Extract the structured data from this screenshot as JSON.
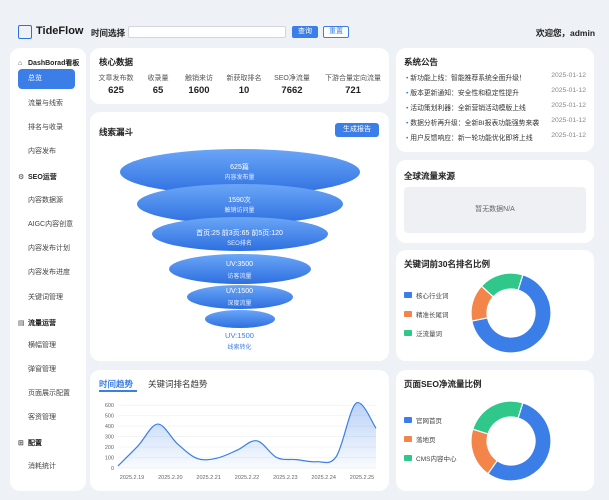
{
  "app": {
    "name": "TideFlow"
  },
  "topbar": {
    "time_label": "时间选择",
    "query_btn": "查询",
    "reset_btn": "重置",
    "welcome": "欢迎您，admin"
  },
  "sidebar": {
    "groups": [
      {
        "label": "DashBorad看板",
        "icon": "home-icon",
        "items": [
          "总览",
          "流量与线索",
          "排名与收录",
          "内容发布"
        ]
      },
      {
        "label": "SEO运营",
        "icon": "gear-icon",
        "items": [
          "内容数据源",
          "AIGC内容创意",
          "内容发布计划",
          "内容发布进度",
          "关键词管理"
        ]
      },
      {
        "label": "流量运营",
        "icon": "calendar-icon",
        "items": [
          "横幅管理",
          "弹窗管理",
          "页面展示配置",
          "客资管理"
        ]
      },
      {
        "label": "配置",
        "icon": "grid-icon",
        "items": [
          "消耗统计"
        ]
      }
    ],
    "active": "总览"
  },
  "core": {
    "title": "核心数据",
    "stats": [
      {
        "label": "文章发布数",
        "value": "625"
      },
      {
        "label": "收录量",
        "value": "65"
      },
      {
        "label": "触销来访",
        "value": "1600"
      },
      {
        "label": "新获取排名",
        "value": "10"
      },
      {
        "label": "SEO净流量",
        "value": "7662"
      },
      {
        "label": "下游合量定向流量",
        "value": "721"
      }
    ]
  },
  "funnel": {
    "title": "线索漏斗",
    "report_btn": "生成报告",
    "layers": [
      {
        "value": "625篇",
        "label": "内容发布量"
      },
      {
        "value": "1590次",
        "label": "触销访问量"
      },
      {
        "value": "首页:25 前3页:65 前5页:120",
        "label": "SEO排名"
      },
      {
        "value": "UV:3500",
        "label": "访客流量"
      },
      {
        "value": "UV:1500",
        "label": "深度流量"
      },
      {
        "value": "UV:1500",
        "label": "线索转化"
      }
    ]
  },
  "announcements": {
    "title": "系统公告",
    "items": [
      {
        "text": "新功能上线：智能推荐系统全面升级！",
        "date": "2025-01-12"
      },
      {
        "text": "版本更新通知：安全性和稳定性提升",
        "date": "2025-01-12"
      },
      {
        "text": "活动策划利器：全新营销活动模版上线",
        "date": "2025-01-12"
      },
      {
        "text": "数据分析再升级：全新BI报表功能强势来袭",
        "date": "2025-01-12"
      },
      {
        "text": "用户反馈响应：新一轮功能优化即将上线",
        "date": "2025-01-12"
      }
    ]
  },
  "global": {
    "title": "全球流量来源",
    "empty": "暂无数据N/A"
  },
  "keyword_pie": {
    "title": "关键词前30名排名比例",
    "legend": [
      {
        "name": "核心行业词",
        "color": "#3b7ee8"
      },
      {
        "name": "精准长尾词",
        "color": "#f3844a"
      },
      {
        "name": "泛流量词",
        "color": "#2fc88a"
      }
    ]
  },
  "seo_pie": {
    "title": "页面SEO净流量比例",
    "legend": [
      {
        "name": "官网首页",
        "color": "#3b7ee8"
      },
      {
        "name": "落地页",
        "color": "#f3844a"
      },
      {
        "name": "CMS内容中心",
        "color": "#2fc88a"
      }
    ]
  },
  "trend": {
    "tabs": [
      "时间趋势",
      "关键词排名趋势"
    ],
    "active_tab": "时间趋势"
  },
  "chart_data": [
    {
      "type": "line",
      "title": "",
      "x": [
        "2025.2.19",
        "2025.2.20",
        "2025.2.21",
        "2025.2.22",
        "2025.2.23",
        "2025.2.24",
        "2025.2.25"
      ],
      "series": [
        {
          "values": [
            20,
            210,
            420,
            230,
            90,
            95,
            170,
            260,
            100,
            80,
            60,
            110,
            620,
            380
          ],
          "x": [
            "2025.2.19",
            "2025.2.19.5",
            "2025.2.20",
            "2025.2.20.5",
            "2025.2.21",
            "2025.2.21.5",
            "2025.2.22",
            "2025.2.22.3",
            "2025.2.22.7",
            "2025.2.23",
            "2025.2.23.5",
            "2025.2.24",
            "2025.2.24.8",
            "2025.2.25.3"
          ]
        }
      ],
      "yticks": [
        0,
        100,
        200,
        300,
        400,
        500,
        600
      ],
      "ylim": [
        0,
        650
      ],
      "area": true,
      "color": "#3b7ee8"
    },
    {
      "type": "pie",
      "title": "关键词前30名排名比例",
      "categories": [
        "核心行业词",
        "精准长尾词",
        "泛流量词"
      ],
      "values": [
        67,
        15,
        18
      ]
    },
    {
      "type": "pie",
      "title": "页面SEO净流量比例",
      "categories": [
        "官网首页",
        "落地页",
        "CMS内容中心"
      ],
      "values": [
        55,
        20,
        25
      ]
    }
  ]
}
